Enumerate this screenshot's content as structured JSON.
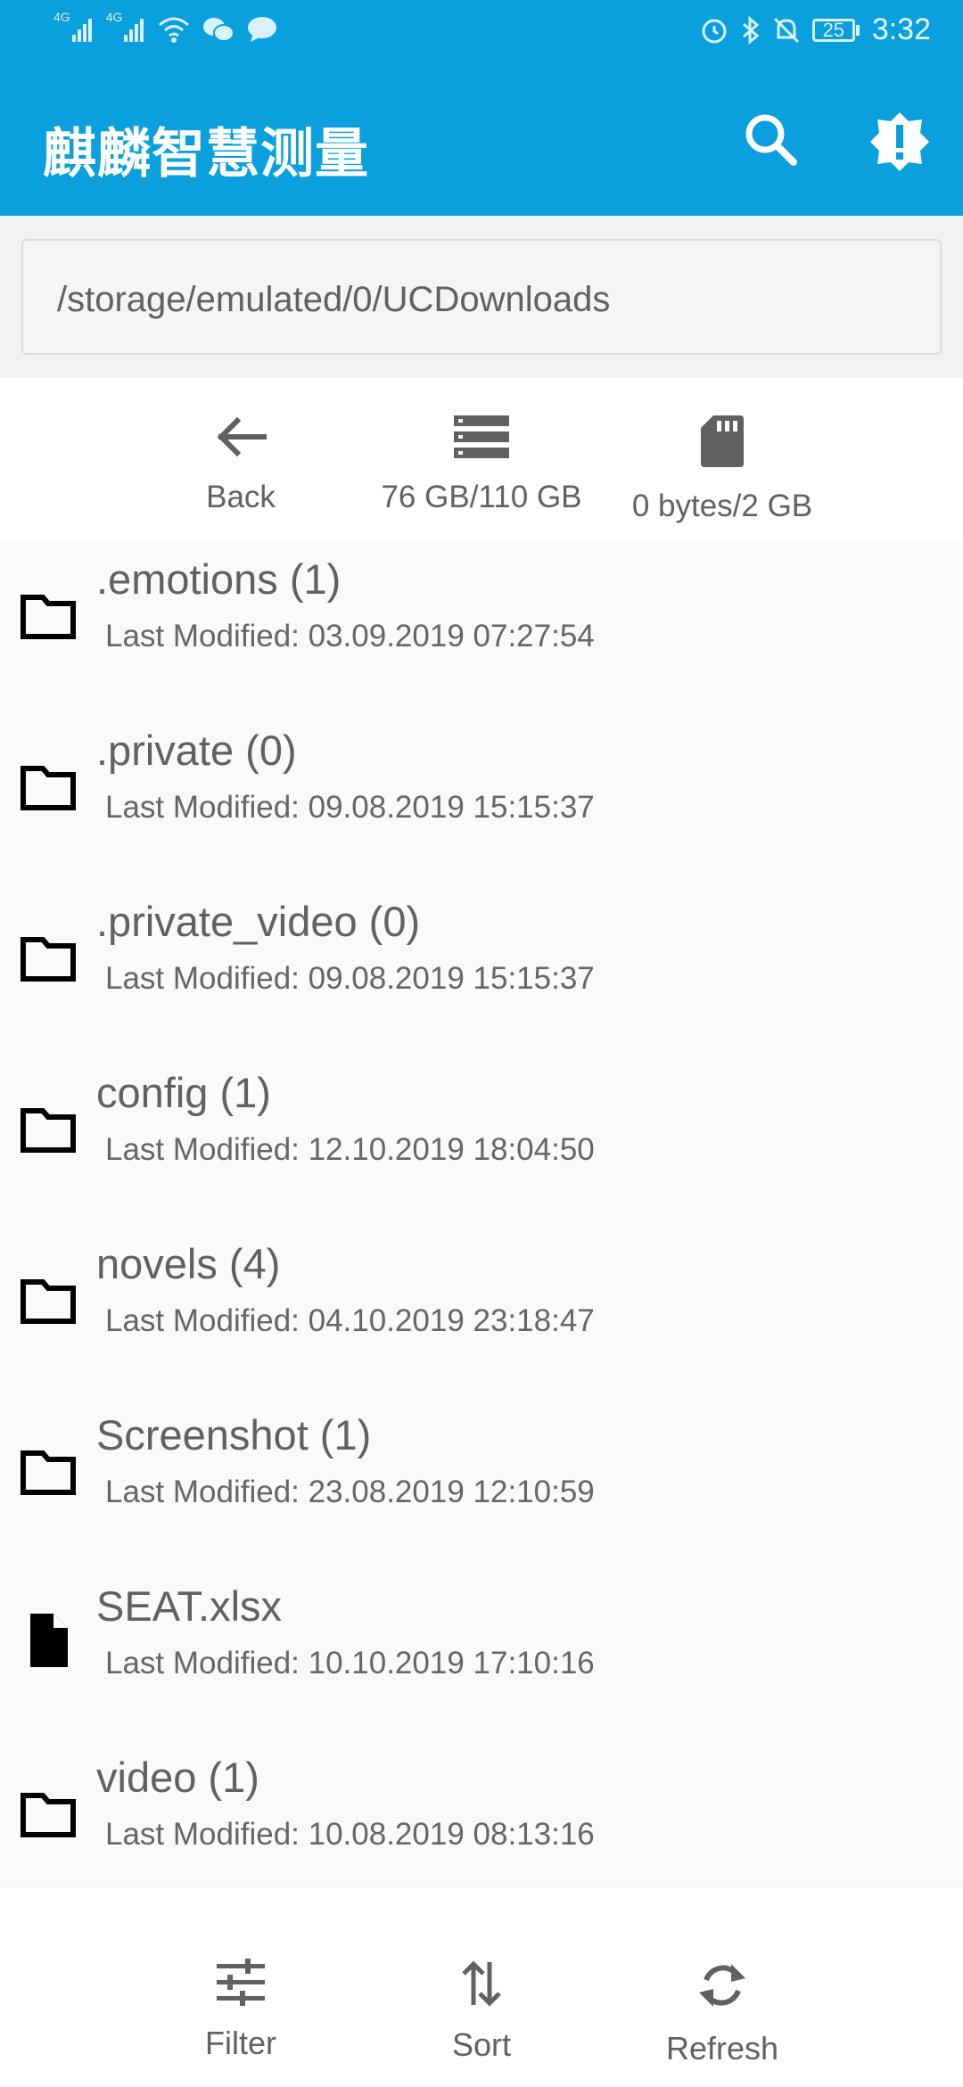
{
  "status_bar": {
    "network_1": "4G",
    "network_2": "4G",
    "battery": "25",
    "time": "3:32"
  },
  "app_bar": {
    "title": "麒麟智慧测量"
  },
  "path": {
    "value": "/storage/emulated/0/UCDownloads"
  },
  "top_actions": {
    "back": "Back",
    "internal_storage": "76 GB/110 GB",
    "sd_card": "0 bytes/2 GB"
  },
  "files": [
    {
      "name": ".emotions (1)",
      "modified": "Last Modified: 03.09.2019 07:27:54",
      "icon": "folder-icon"
    },
    {
      "name": ".private (0)",
      "modified": "Last Modified: 09.08.2019 15:15:37",
      "icon": "folder-icon"
    },
    {
      "name": ".private_video (0)",
      "modified": "Last Modified: 09.08.2019 15:15:37",
      "icon": "folder-icon"
    },
    {
      "name": "config (1)",
      "modified": "Last Modified: 12.10.2019 18:04:50",
      "icon": "folder-icon"
    },
    {
      "name": "novels (4)",
      "modified": "Last Modified: 04.10.2019 23:18:47",
      "icon": "folder-icon"
    },
    {
      "name": "Screenshot (1)",
      "modified": "Last Modified: 23.08.2019 12:10:59",
      "icon": "folder-icon"
    },
    {
      "name": "SEAT.xlsx",
      "modified": "Last Modified: 10.10.2019 17:10:16",
      "icon": "file-icon"
    },
    {
      "name": "video (1)",
      "modified": "Last Modified: 10.08.2019 08:13:16",
      "icon": "folder-icon"
    }
  ],
  "bottom_bar": {
    "filter": "Filter",
    "sort": "Sort",
    "refresh": "Refresh"
  },
  "colors": {
    "app_bar": "#0aa0de",
    "text_secondary": "#616161"
  }
}
